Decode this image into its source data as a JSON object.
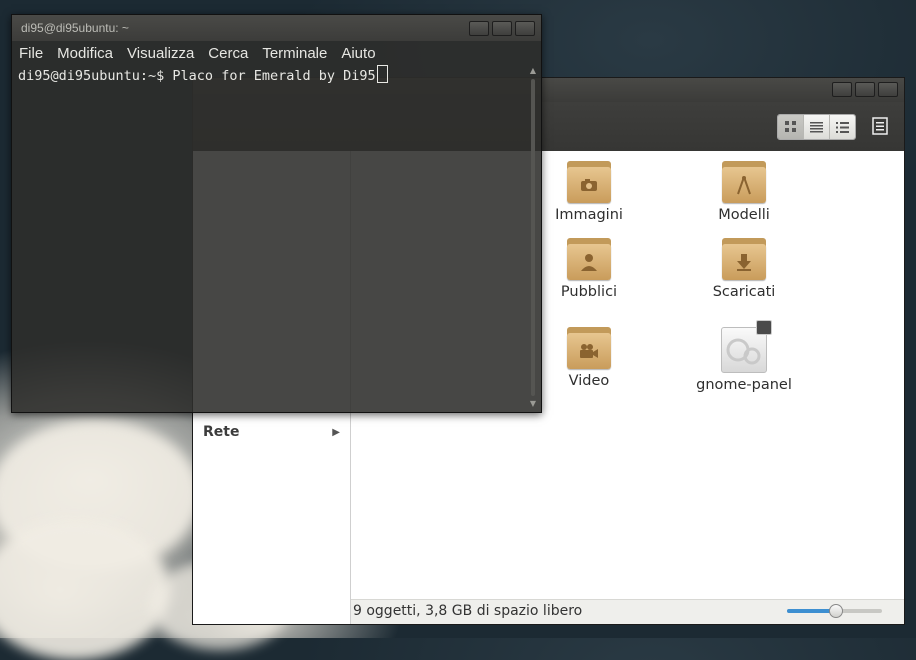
{
  "file_manager": {
    "sidebar": {
      "sections": [
        {
          "label": "Rete"
        }
      ]
    },
    "files": [
      {
        "label": "Immagini",
        "icon": "camera-icon"
      },
      {
        "label": "Modelli",
        "icon": "compass-icon"
      },
      {
        "label": "Pubblici",
        "icon": "person-icon"
      },
      {
        "label": "Scaricati",
        "icon": "download-arrow-icon"
      },
      {
        "label": "Video",
        "icon": "film-camera-icon"
      },
      {
        "label": "gnome-panel",
        "icon": "generic-file-icon"
      }
    ],
    "status": "9 oggetti, 3,8 GB di spazio libero",
    "zoom_level": 0.5
  },
  "terminal": {
    "title": "di95@di95ubuntu: ~",
    "menu": [
      "File",
      "Modifica",
      "Visualizza",
      "Cerca",
      "Terminale",
      "Aiuto"
    ],
    "prompt_line": "di95@di95ubuntu:~$ Placo for Emerald by Di95"
  },
  "colors": {
    "accent": "#3d8fd1",
    "folder": "#d5ab6b"
  }
}
